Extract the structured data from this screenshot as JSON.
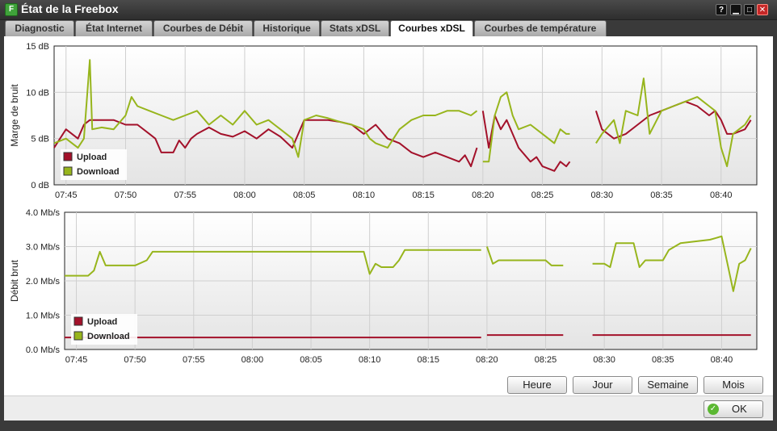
{
  "window": {
    "title": "État de la Freebox",
    "app_icon": "freebox-logo-icon",
    "buttons": [
      {
        "name": "help",
        "glyph": "?"
      },
      {
        "name": "minimize",
        "glyph": "▁"
      },
      {
        "name": "maximize",
        "glyph": "□"
      },
      {
        "name": "close",
        "glyph": "✕"
      }
    ]
  },
  "tabs": [
    {
      "label": "Diagnostic",
      "active": false
    },
    {
      "label": "État Internet",
      "active": false
    },
    {
      "label": "Courbes de Débit",
      "active": false
    },
    {
      "label": "Historique",
      "active": false
    },
    {
      "label": "Stats xDSL",
      "active": false
    },
    {
      "label": "Courbes xDSL",
      "active": true
    },
    {
      "label": "Courbes de température",
      "active": false
    }
  ],
  "range_buttons": [
    "Heure",
    "Jour",
    "Semaine",
    "Mois"
  ],
  "ok_label": "OK",
  "colors": {
    "upload": "#a3112a",
    "download": "#97b51c"
  },
  "chart_data": [
    {
      "type": "line",
      "ylabel": "Marge de bruit",
      "ylim": [
        0,
        15
      ],
      "y_ticks": [
        "0 dB",
        "5 dB",
        "10 dB",
        "15 dB"
      ],
      "y_tick_values": [
        0,
        5,
        10,
        15
      ],
      "xlim": [
        44,
        103
      ],
      "x_ticks": [
        "07:45",
        "07:50",
        "07:55",
        "08:00",
        "08:05",
        "08:10",
        "08:15",
        "08:20",
        "08:25",
        "08:30",
        "08:35",
        "08:40"
      ],
      "x_tick_values": [
        45,
        50,
        55,
        60,
        65,
        70,
        75,
        80,
        85,
        90,
        95,
        100
      ],
      "grid": true,
      "legend": "bottom-left",
      "series": [
        {
          "name": "Upload",
          "color": "#a3112a",
          "points": [
            [
              [
                44.0,
                4.0
              ],
              [
                45,
                6.0
              ],
              [
                46,
                5.0
              ],
              [
                46.5,
                6.5
              ],
              [
                47,
                7.0
              ],
              [
                49,
                7.0
              ],
              [
                50,
                6.5
              ],
              [
                51,
                6.5
              ],
              [
                52,
                5.5
              ],
              [
                52.5,
                5.0
              ],
              [
                53,
                3.5
              ],
              [
                54,
                3.5
              ],
              [
                54.5,
                4.8
              ],
              [
                55,
                4.0
              ],
              [
                55.5,
                5.0
              ],
              [
                56,
                5.5
              ],
              [
                57,
                6.2
              ],
              [
                58,
                5.5
              ],
              [
                59,
                5.2
              ],
              [
                60,
                5.8
              ],
              [
                61,
                5.0
              ],
              [
                62,
                6.0
              ],
              [
                63,
                5.2
              ],
              [
                64,
                4.0
              ],
              [
                64.5,
                5.5
              ],
              [
                65,
                7.0
              ],
              [
                67,
                7.0
              ],
              [
                68,
                6.8
              ],
              [
                69,
                6.5
              ],
              [
                70,
                5.5
              ],
              [
                71,
                6.5
              ],
              [
                72,
                5.0
              ],
              [
                73,
                4.5
              ],
              [
                74,
                3.5
              ],
              [
                75,
                3.0
              ],
              [
                76,
                3.5
              ],
              [
                77,
                3.0
              ],
              [
                78,
                2.5
              ],
              [
                78.5,
                3.2
              ],
              [
                79,
                2.0
              ],
              [
                79.5,
                4.0
              ]
            ],
            [
              [
                80,
                8.0
              ],
              [
                80.5,
                4.0
              ],
              [
                81,
                7.5
              ],
              [
                81.5,
                6.0
              ],
              [
                82,
                7.0
              ],
              [
                82.5,
                5.5
              ],
              [
                83,
                4.0
              ],
              [
                84,
                2.5
              ],
              [
                84.5,
                3.0
              ],
              [
                85,
                2.0
              ],
              [
                86,
                1.5
              ],
              [
                86.5,
                2.5
              ],
              [
                87,
                2.0
              ],
              [
                87.3,
                2.5
              ]
            ],
            [
              [
                89.5,
                8.0
              ],
              [
                90,
                6.0
              ],
              [
                91,
                5.0
              ],
              [
                92,
                5.5
              ],
              [
                93,
                6.5
              ],
              [
                94,
                7.5
              ],
              [
                95,
                8.0
              ],
              [
                96,
                8.5
              ],
              [
                97,
                9.0
              ],
              [
                98,
                8.5
              ],
              [
                99,
                7.5
              ],
              [
                99.5,
                8.0
              ],
              [
                100,
                7.0
              ],
              [
                100.5,
                5.5
              ],
              [
                101,
                5.5
              ],
              [
                102,
                6.0
              ],
              [
                102.5,
                7.0
              ]
            ]
          ]
        },
        {
          "name": "Download",
          "color": "#97b51c",
          "points": [
            [
              [
                44.0,
                4.5
              ],
              [
                45,
                5.0
              ],
              [
                46,
                4.0
              ],
              [
                46.5,
                5.0
              ],
              [
                47,
                13.5
              ],
              [
                47.2,
                6.0
              ],
              [
                48,
                6.2
              ],
              [
                49,
                6.0
              ],
              [
                50,
                7.5
              ],
              [
                50.5,
                9.5
              ],
              [
                51,
                8.5
              ],
              [
                52,
                8.0
              ],
              [
                53,
                7.5
              ],
              [
                54,
                7.0
              ],
              [
                55,
                7.5
              ],
              [
                56,
                8.0
              ],
              [
                57,
                6.5
              ],
              [
                58,
                7.5
              ],
              [
                59,
                6.5
              ],
              [
                60,
                8.0
              ],
              [
                61,
                6.5
              ],
              [
                62,
                7.0
              ],
              [
                62.5,
                6.5
              ],
              [
                63,
                6.0
              ],
              [
                64,
                5.0
              ],
              [
                64.5,
                3.0
              ],
              [
                65,
                7.0
              ],
              [
                66,
                7.5
              ],
              [
                67,
                7.2
              ],
              [
                68,
                6.8
              ],
              [
                69,
                6.5
              ],
              [
                70,
                6.0
              ],
              [
                70.5,
                5.0
              ],
              [
                71,
                4.5
              ],
              [
                72,
                4.0
              ],
              [
                73,
                6.0
              ],
              [
                74,
                7.0
              ],
              [
                75,
                7.5
              ],
              [
                76,
                7.5
              ],
              [
                77,
                8.0
              ],
              [
                78,
                8.0
              ],
              [
                79,
                7.5
              ],
              [
                79.5,
                8.0
              ]
            ],
            [
              [
                80,
                2.5
              ],
              [
                80.5,
                2.5
              ],
              [
                81,
                7.5
              ],
              [
                81.5,
                9.5
              ],
              [
                82,
                10.0
              ],
              [
                82.5,
                7.5
              ],
              [
                83,
                6.0
              ],
              [
                84,
                6.5
              ],
              [
                85,
                5.5
              ],
              [
                86,
                4.5
              ],
              [
                86.5,
                6.0
              ],
              [
                87,
                5.5
              ],
              [
                87.3,
                5.5
              ]
            ],
            [
              [
                89.5,
                4.5
              ],
              [
                90,
                5.5
              ],
              [
                91,
                7.0
              ],
              [
                91.5,
                4.5
              ],
              [
                92,
                8.0
              ],
              [
                93,
                7.5
              ],
              [
                93.5,
                11.5
              ],
              [
                94,
                5.5
              ],
              [
                95,
                8.0
              ],
              [
                96,
                8.5
              ],
              [
                97,
                9.0
              ],
              [
                98,
                9.5
              ],
              [
                99,
                8.5
              ],
              [
                99.5,
                8.0
              ],
              [
                100,
                4.0
              ],
              [
                100.5,
                2.0
              ],
              [
                101,
                5.5
              ],
              [
                102,
                6.5
              ],
              [
                102.5,
                7.5
              ]
            ]
          ]
        }
      ]
    },
    {
      "type": "line",
      "ylabel": "Débit brut",
      "ylim": [
        0,
        4
      ],
      "y_ticks": [
        "0.0 Mb/s",
        "1.0 Mb/s",
        "2.0 Mb/s",
        "3.0 Mb/s",
        "4.0 Mb/s"
      ],
      "y_tick_values": [
        0,
        1,
        2,
        3,
        4
      ],
      "xlim": [
        44,
        103
      ],
      "x_ticks": [
        "07:45",
        "07:50",
        "07:55",
        "08:00",
        "08:05",
        "08:10",
        "08:15",
        "08:20",
        "08:25",
        "08:30",
        "08:35",
        "08:40"
      ],
      "x_tick_values": [
        45,
        50,
        55,
        60,
        65,
        70,
        75,
        80,
        85,
        90,
        95,
        100
      ],
      "grid": true,
      "legend": "bottom-left",
      "series": [
        {
          "name": "Upload",
          "color": "#a3112a",
          "points": [
            [
              [
                44.0,
                0.35
              ],
              [
                79.5,
                0.35
              ]
            ],
            [
              [
                80,
                0.42
              ],
              [
                86.5,
                0.42
              ]
            ],
            [
              [
                89,
                0.42
              ],
              [
                102.5,
                0.42
              ]
            ]
          ]
        },
        {
          "name": "Download",
          "color": "#97b51c",
          "points": [
            [
              [
                44.0,
                2.15
              ],
              [
                46,
                2.15
              ],
              [
                46.5,
                2.3
              ],
              [
                47,
                2.85
              ],
              [
                47.5,
                2.45
              ],
              [
                50,
                2.45
              ],
              [
                51,
                2.6
              ],
              [
                51.5,
                2.85
              ],
              [
                69.5,
                2.85
              ],
              [
                70,
                2.2
              ],
              [
                70.5,
                2.5
              ],
              [
                71,
                2.4
              ],
              [
                72,
                2.4
              ],
              [
                72.5,
                2.6
              ],
              [
                73,
                2.9
              ],
              [
                79.5,
                2.9
              ]
            ],
            [
              [
                80,
                3.0
              ],
              [
                80.5,
                2.5
              ],
              [
                81,
                2.6
              ],
              [
                85,
                2.6
              ],
              [
                85.5,
                2.45
              ],
              [
                86.5,
                2.45
              ]
            ],
            [
              [
                89,
                2.5
              ],
              [
                90,
                2.5
              ],
              [
                90.5,
                2.4
              ],
              [
                91,
                3.1
              ],
              [
                92.5,
                3.1
              ],
              [
                93,
                2.4
              ],
              [
                93.5,
                2.6
              ],
              [
                95,
                2.6
              ],
              [
                95.5,
                2.9
              ],
              [
                96.5,
                3.1
              ],
              [
                99,
                3.2
              ],
              [
                99.5,
                3.25
              ],
              [
                100,
                3.3
              ],
              [
                100.5,
                2.5
              ],
              [
                101,
                1.7
              ],
              [
                101.5,
                2.5
              ],
              [
                102,
                2.6
              ],
              [
                102.5,
                2.95
              ]
            ]
          ]
        }
      ]
    }
  ]
}
